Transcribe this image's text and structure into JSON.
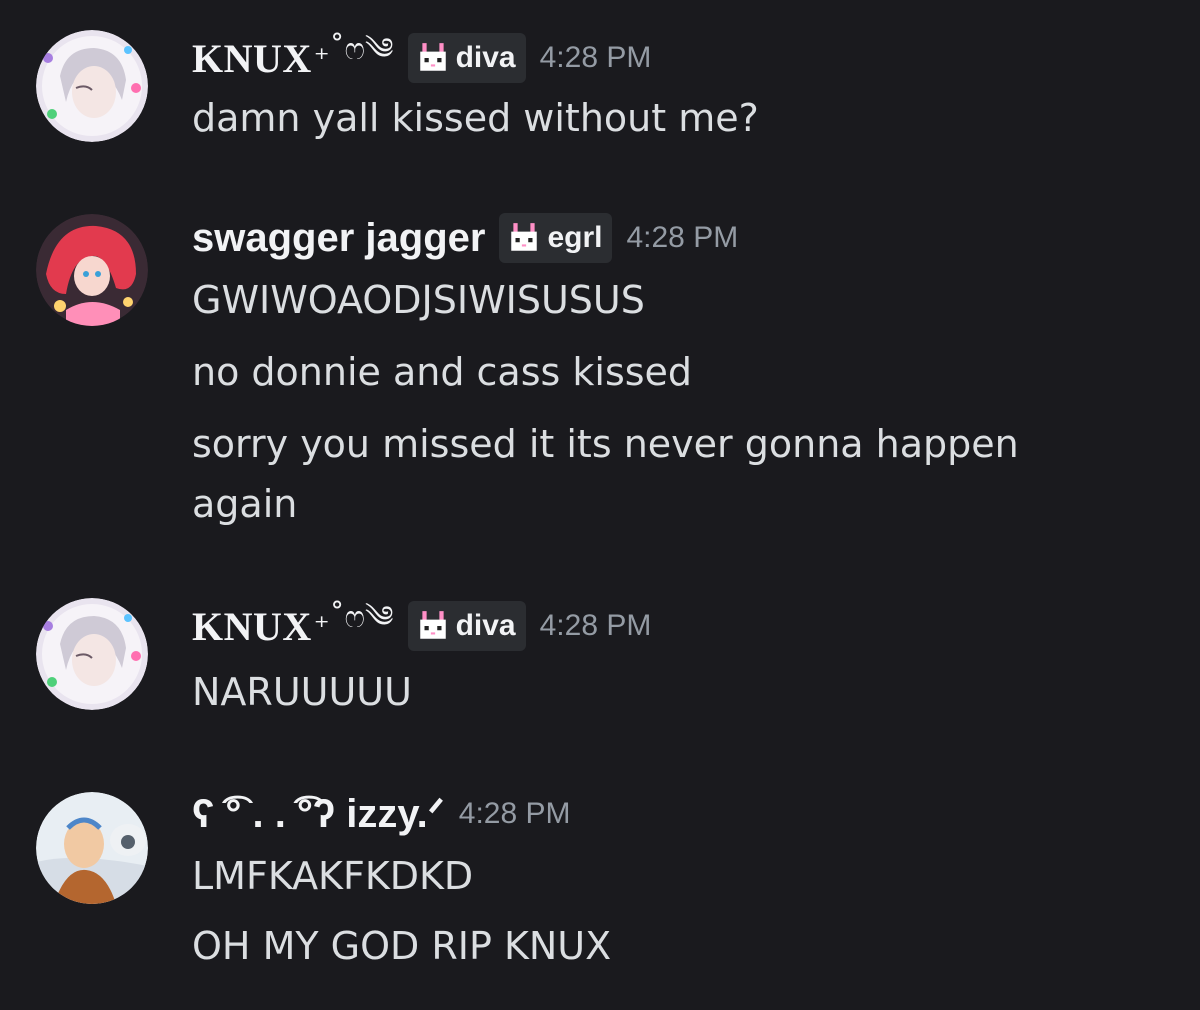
{
  "messages": [
    {
      "username": "KNUX",
      "username_deco": "₊˚ෆ༄",
      "tag": "diva",
      "time": "4:28 PM",
      "lines": [
        "damn yall kissed without me?"
      ]
    },
    {
      "username": "swagger jagger",
      "tag": "egrl",
      "time": "4:28 PM",
      "lines": [
        "GWIWOAODJSIWISUSUS",
        "no donnie and cass kissed",
        "sorry you missed it its never gonna happen again"
      ]
    },
    {
      "username": "KNUX",
      "username_deco": "₊˚ෆ༄",
      "tag": "diva",
      "time": "4:28 PM",
      "lines": [
        "NARUUUUU"
      ]
    },
    {
      "username": "ʕ ͡° . . ͡°ʔ izzy.ᐟ",
      "time": "4:28 PM",
      "lines": [
        "LMFKAKFKDKD",
        "OH MY GOD RIP KNUX"
      ]
    }
  ],
  "colors": {
    "background": "#1a1a1e",
    "username": "#f2f3f5",
    "message_text": "#dbdee1",
    "timestamp": "#949ba4",
    "tag_background": "#2b2d31"
  }
}
